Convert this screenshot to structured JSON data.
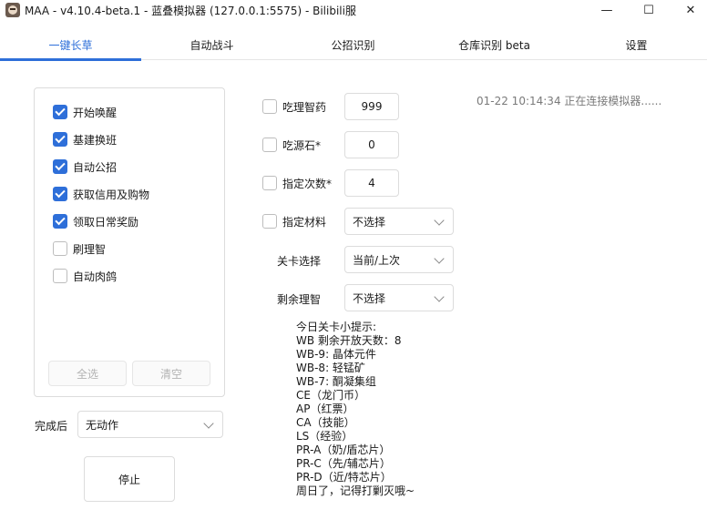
{
  "window": {
    "title": "MAA - v4.10.4-beta.1 - 蓝叠模拟器 (127.0.0.1:5575) - Bilibili服",
    "minimize_glyph": "—",
    "maximize_glyph": "☐",
    "close_glyph": "✕"
  },
  "tabs": [
    {
      "label": "一键长草",
      "active": true
    },
    {
      "label": "自动战斗",
      "active": false
    },
    {
      "label": "公招识别",
      "active": false
    },
    {
      "label": "仓库识别 beta",
      "active": false
    },
    {
      "label": "设置",
      "active": false
    }
  ],
  "tasks": [
    {
      "label": "开始唤醒",
      "checked": true
    },
    {
      "label": "基建换班",
      "checked": true
    },
    {
      "label": "自动公招",
      "checked": true
    },
    {
      "label": "获取信用及购物",
      "checked": true
    },
    {
      "label": "领取日常奖励",
      "checked": true
    },
    {
      "label": "刷理智",
      "checked": false
    },
    {
      "label": "自动肉鸽",
      "checked": false
    }
  ],
  "task_buttons": {
    "select_all": "全选",
    "clear": "清空"
  },
  "after_completion": {
    "label": "完成后",
    "value": "无动作"
  },
  "stop_button": "停止",
  "settings": {
    "use_medicine": {
      "label": "吃理智药",
      "checked": false,
      "value": "999"
    },
    "use_stone": {
      "label": "吃源石*",
      "checked": false,
      "value": "0"
    },
    "times": {
      "label": "指定次数*",
      "checked": false,
      "value": "4"
    },
    "material": {
      "label": "指定材料",
      "checked": false,
      "value": "不选择"
    },
    "stage": {
      "label": "关卡选择",
      "value": "当前/上次"
    },
    "remaining": {
      "label": "剩余理智",
      "value": "不选择"
    }
  },
  "tips": [
    "今日关卡小提示:",
    "WB 剩余开放天数：8",
    "WB-9: 晶体元件",
    "WB-8: 轻锰矿",
    "WB-7: 酮凝集组",
    "CE（龙门币）",
    "AP（红票）",
    "CA（技能）",
    "LS（经验）",
    "PR-A（奶/盾芯片）",
    "PR-C（先/辅芯片）",
    "PR-D（近/特芯片）",
    "周日了，记得打剿灭哦~"
  ],
  "log": {
    "time": "01-22  10:14:34",
    "message": "正在连接模拟器......"
  },
  "colors": {
    "accent": "#2e6fd9",
    "border": "#dcdcdc",
    "disabled_text": "#b3b3b3",
    "log_text": "#7a7a7a"
  }
}
